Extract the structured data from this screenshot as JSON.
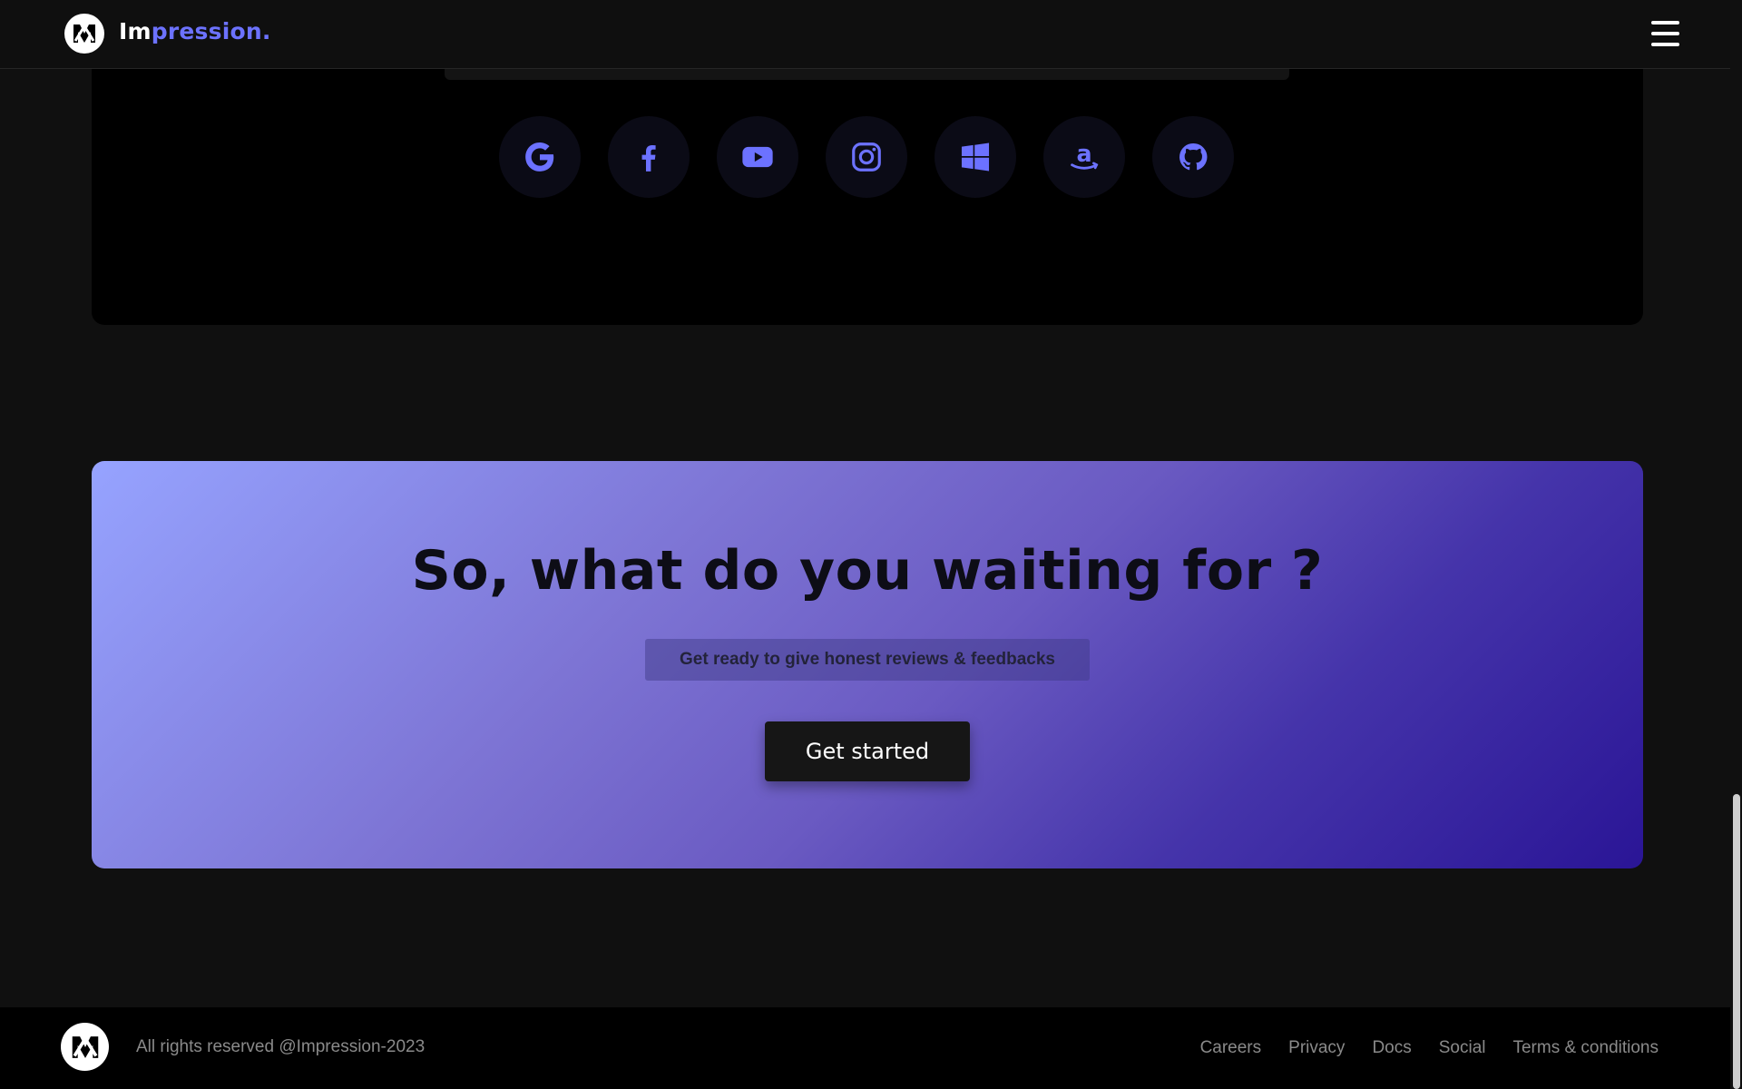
{
  "brand": {
    "part1": "Im",
    "part2": "pression.",
    "accent_color": "#6c72ff"
  },
  "nav": {
    "menu_icon": "hamburger-menu-icon"
  },
  "socials": [
    {
      "name": "google",
      "icon": "google-icon"
    },
    {
      "name": "facebook",
      "icon": "facebook-icon"
    },
    {
      "name": "youtube",
      "icon": "youtube-icon"
    },
    {
      "name": "instagram",
      "icon": "instagram-icon"
    },
    {
      "name": "windows",
      "icon": "windows-icon"
    },
    {
      "name": "amazon",
      "icon": "amazon-icon"
    },
    {
      "name": "github",
      "icon": "github-icon"
    }
  ],
  "social_icon_color": "#6c72ff",
  "cta": {
    "title": "So, what do you waiting for ?",
    "subtitle": "Get ready to give honest reviews & feedbacks",
    "button_label": "Get started",
    "gradient": [
      "#96a3ff",
      "#2a1596"
    ]
  },
  "footer": {
    "copyright": "All rights reserved @Impression-2023",
    "links": [
      "Careers",
      "Privacy",
      "Docs",
      "Social",
      "Terms & conditions"
    ]
  }
}
